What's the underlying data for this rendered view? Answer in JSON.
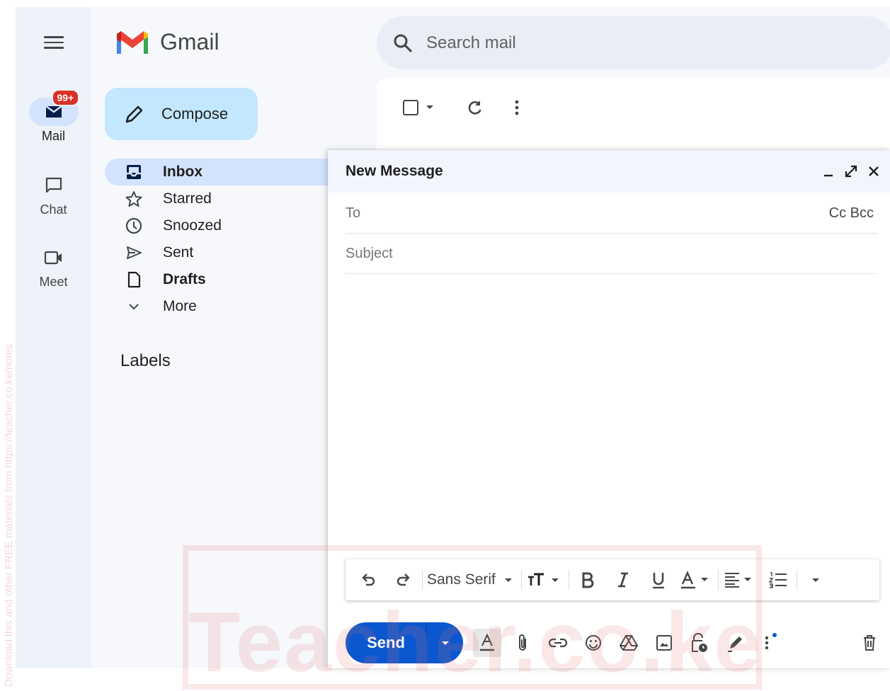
{
  "app": {
    "name": "Gmail"
  },
  "rail": {
    "mail_label": "Mail",
    "mail_badge": "99+",
    "chat_label": "Chat",
    "meet_label": "Meet"
  },
  "search": {
    "placeholder": "Search mail"
  },
  "compose_button": {
    "label": "Compose"
  },
  "nav": {
    "items": [
      {
        "label": "Inbox",
        "icon": "inbox-icon",
        "active": true,
        "bold": true
      },
      {
        "label": "Starred",
        "icon": "star-icon"
      },
      {
        "label": "Snoozed",
        "icon": "clock-icon"
      },
      {
        "label": "Sent",
        "icon": "send-icon"
      },
      {
        "label": "Drafts",
        "icon": "draft-icon",
        "bold": true
      },
      {
        "label": "More",
        "icon": "chevron-down-icon"
      }
    ],
    "labels_heading": "Labels"
  },
  "compose_window": {
    "title": "New Message",
    "to_placeholder": "To",
    "cc_bcc": "Cc Bcc",
    "subject_placeholder": "Subject",
    "font_name": "Sans Serif",
    "send_label": "Send"
  },
  "watermark": {
    "text": "Teacher.co.ke",
    "side_text": "Download this and other FREE materials from https://teacher.co.ke/notes"
  },
  "colors": {
    "accent": "#0b57d0",
    "compose_bg": "#c2e7ff",
    "active_nav": "#d3e3fd",
    "badge": "#d93025"
  }
}
